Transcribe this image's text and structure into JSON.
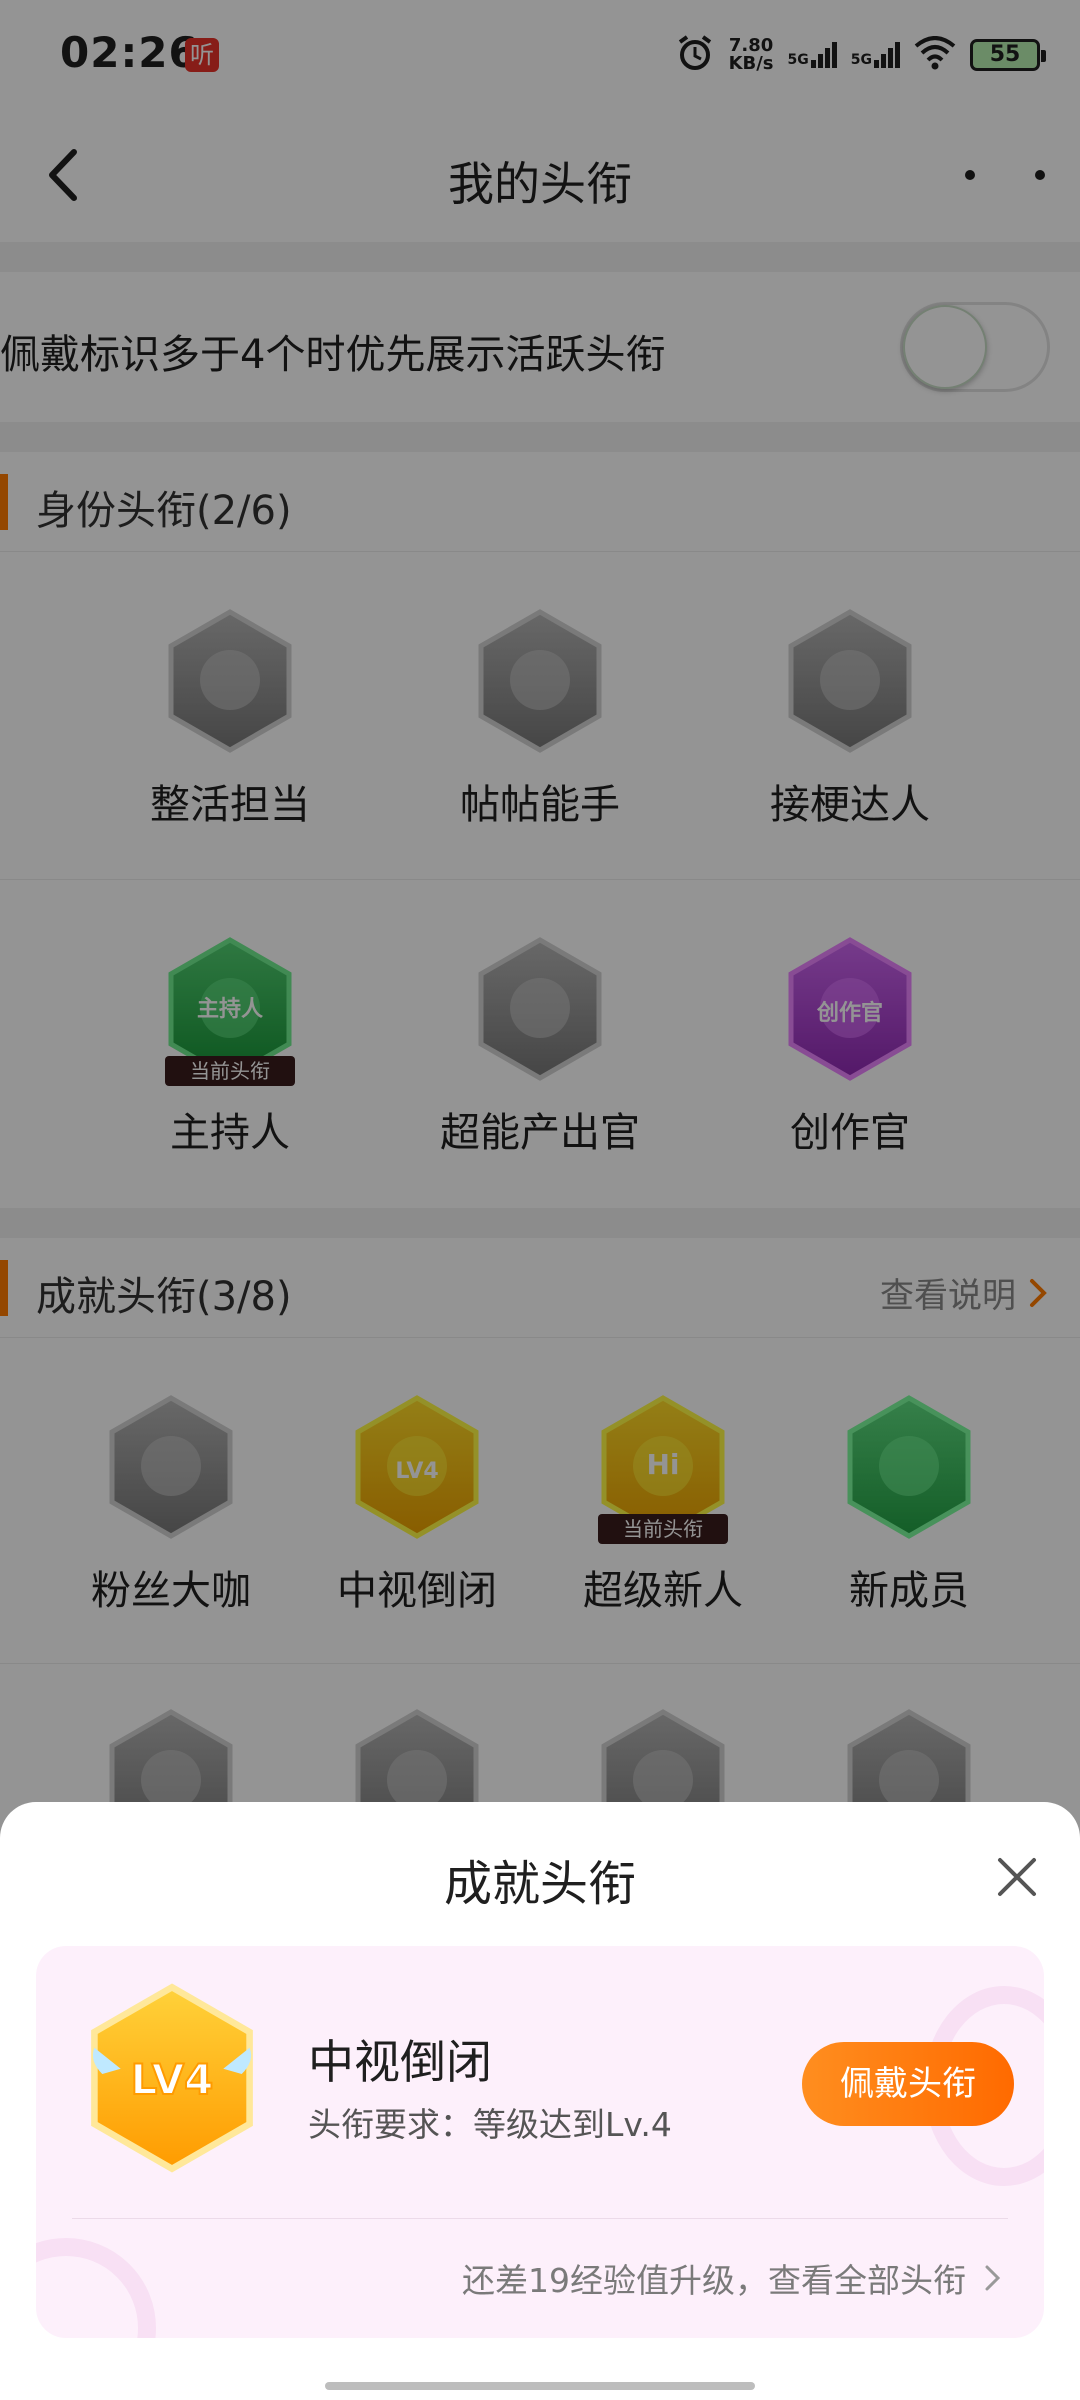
{
  "status_bar": {
    "time": "02:26",
    "tag": "听",
    "net_speed_value": "7.80",
    "net_speed_unit": "KB/s",
    "signal1": "5G",
    "signal2": "5G",
    "battery": "55"
  },
  "nav": {
    "title": "我的头衔"
  },
  "preference": {
    "text": "佩戴标识多于4个时优先展示活跃头衔",
    "enabled": false
  },
  "identity": {
    "title": "身份头衔(2/6)",
    "row1": [
      {
        "label": "整活担当",
        "color": "gray"
      },
      {
        "label": "帖帖能手",
        "color": "gray"
      },
      {
        "label": "接梗达人",
        "color": "gray"
      }
    ],
    "row2": [
      {
        "label": "主持人",
        "color": "#2aa84a",
        "badge_text": "主持人",
        "current": "当前头衔"
      },
      {
        "label": "超能产出官",
        "color": "gray"
      },
      {
        "label": "创作官",
        "color": "#a43ec8",
        "badge_text": "创作官"
      }
    ]
  },
  "achievement": {
    "title": "成就头衔(3/8)",
    "link": "查看说明",
    "row1": [
      {
        "label": "粉丝大咖",
        "color": "gray"
      },
      {
        "label": "中视倒闭",
        "color": "#ffb400",
        "badge_text": "LV4"
      },
      {
        "label": "超级新人",
        "color": "#ffb400",
        "badge_text": "Hi",
        "current": "当前头衔"
      },
      {
        "label": "新成员",
        "color": "#36b558"
      }
    ]
  },
  "sheet": {
    "title": "成就头衔",
    "name": "中视倒闭",
    "requirement": "头衔要求：等级达到Lv.4",
    "wear_button": "佩戴头衔",
    "footer": "还差19经验值升级，查看全部头衔",
    "badge_text": "LV4"
  }
}
